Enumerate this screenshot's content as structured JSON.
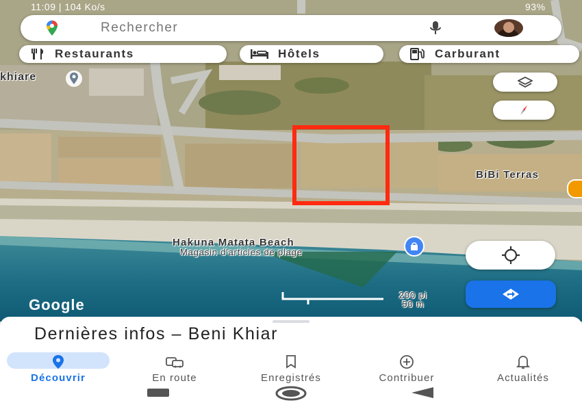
{
  "status_bar": {
    "time": "11:09",
    "speed": "104 Ko/s",
    "battery": "93%"
  },
  "search": {
    "placeholder": "Rechercher"
  },
  "chips": [
    {
      "label": "Restaurants",
      "icon": "fork-knife-icon"
    },
    {
      "label": "Hôtels",
      "icon": "bed-icon"
    },
    {
      "label": "Carburant",
      "icon": "fuel-pump-icon"
    }
  ],
  "map_labels": {
    "place_left": "khiare",
    "place_right": "BiBi Terras",
    "beach_name": "Hakuna Matata Beach",
    "beach_category": "Magasin d'articles de plage",
    "watermark": "Google"
  },
  "scale": {
    "imperial": "200 pi",
    "metric": "50 m"
  },
  "sheet": {
    "title": "Dernières infos – Beni Khiar"
  },
  "bottom_nav": [
    {
      "label": "Découvrir",
      "icon": "explore-pin-icon",
      "active": true
    },
    {
      "label": "En route",
      "icon": "commute-car-icon",
      "active": false
    },
    {
      "label": "Enregistrés",
      "icon": "bookmark-icon",
      "active": false
    },
    {
      "label": "Contribuer",
      "icon": "add-circle-icon",
      "active": false
    },
    {
      "label": "Actualités",
      "icon": "bell-icon",
      "active": false
    }
  ],
  "colors": {
    "accent": "#1a73e8",
    "highlight_box": "#ff2a10",
    "nav_active": "#1a73e8"
  }
}
